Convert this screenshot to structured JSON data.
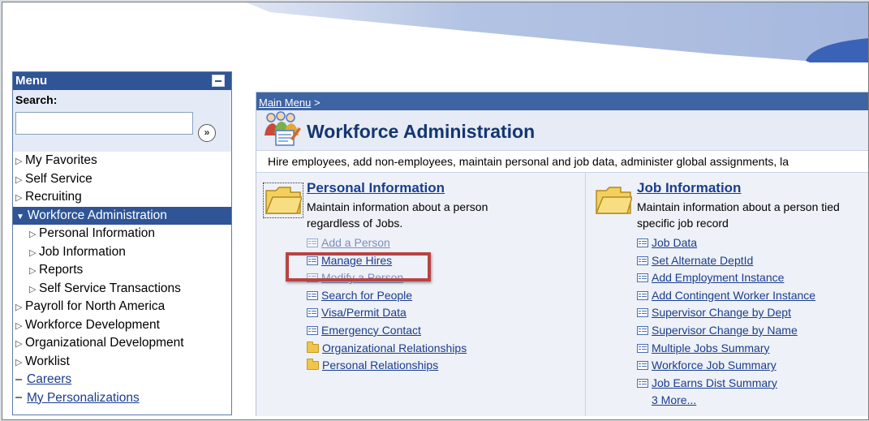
{
  "menu": {
    "header": "Menu",
    "search_label": "Search:",
    "search_value": "",
    "items": [
      {
        "label": "My Favorites"
      },
      {
        "label": "Self Service"
      },
      {
        "label": "Recruiting"
      },
      {
        "label": "Workforce Administration"
      },
      {
        "label": "Personal Information"
      },
      {
        "label": "Job Information"
      },
      {
        "label": "Reports"
      },
      {
        "label": "Self Service Transactions"
      },
      {
        "label": "Payroll for North America"
      },
      {
        "label": "Workforce Development"
      },
      {
        "label": "Organizational Development"
      },
      {
        "label": "Worklist"
      },
      {
        "label": "Careers"
      },
      {
        "label": "My Personalizations"
      }
    ]
  },
  "breadcrumb": {
    "main_menu": "Main Menu",
    "separator": ">"
  },
  "page": {
    "title": "Workforce Administration",
    "description": "Hire employees, add non-employees, maintain personal and job data, administer global assignments, la"
  },
  "personal": {
    "title": "Personal Information",
    "desc_line1": "Maintain information about a person",
    "desc_line2": "regardless of Jobs.",
    "links": [
      "Add a Person",
      "Manage Hires",
      "Modify a Person",
      "Search for People",
      "Visa/Permit Data",
      "Emergency Contact",
      "Organizational Relationships",
      "Personal Relationships"
    ]
  },
  "job": {
    "title": "Job Information",
    "desc_line1": "Maintain information about a person tied",
    "desc_line2": "specific job record",
    "links": [
      "Job Data",
      "Set Alternate DeptId",
      "Add Employment Instance",
      "Add Contingent Worker Instance",
      "Supervisor Change by Dept",
      "Supervisor Change by Name",
      "Multiple Jobs Summary",
      "Workforce Job Summary",
      "Job Earns Dist Summary"
    ],
    "more": "3 More..."
  },
  "colors": {
    "menu_header": "#2f5597",
    "active_item": "#2f5597",
    "link": "#1a3d8f",
    "highlight": "#b84343"
  }
}
